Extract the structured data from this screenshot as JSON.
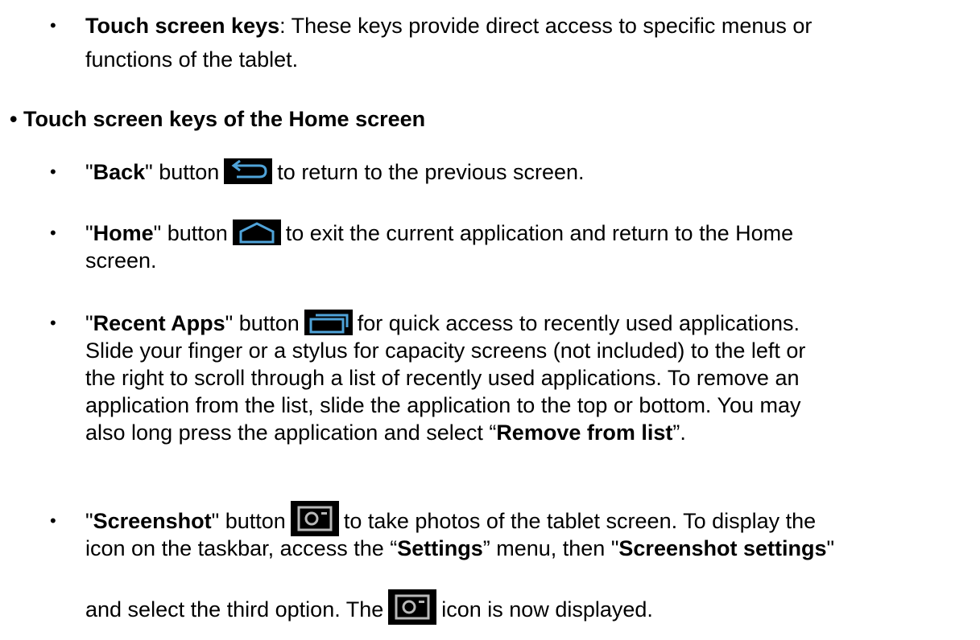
{
  "intro": {
    "term": "Touch screen keys",
    "text1": ": These keys provide direct access to specific menus or",
    "text2": "functions of the tablet."
  },
  "section_heading": "• Touch screen keys of the Home screen",
  "items": {
    "back": {
      "q1": "\"",
      "label": "Back",
      "q2": "\" button",
      "text": "to return to the previous screen.",
      "icon": "back-arrow-icon"
    },
    "home": {
      "q1": "\"",
      "label": "Home",
      "q2": "\" button",
      "text1": "to exit the current application and return to the Home",
      "text2": "screen.",
      "icon": "home-icon"
    },
    "recent": {
      "q1": "\"",
      "label": "Recent Apps",
      "q2": "\" button",
      "text1": "for quick access to recently used applications.",
      "line2": "Slide your finger or a stylus for capacity screens (not included) to the left or",
      "line3": "the right to scroll through a list of recently used applications. To remove an",
      "line4": "application from the list, slide the application to the top or bottom. You may",
      "line5a": "also long press the application and select “",
      "line5b": "Remove from list",
      "line5c": "”.",
      "icon": "recent-apps-icon"
    },
    "screenshot": {
      "q1": "\"",
      "label": "Screenshot",
      "q2": "\" button",
      "text1": "to take photos of the tablet screen. To display the",
      "line2a": "icon on the taskbar, access the “",
      "line2b": "Settings",
      "line2c": "” menu, then \"",
      "line2d": "Screenshot settings",
      "line2e": "\"",
      "line3a": "and select the third option. The",
      "line3b": "icon is now displayed.",
      "icon": "camera-icon"
    }
  },
  "bullet_char": "•"
}
